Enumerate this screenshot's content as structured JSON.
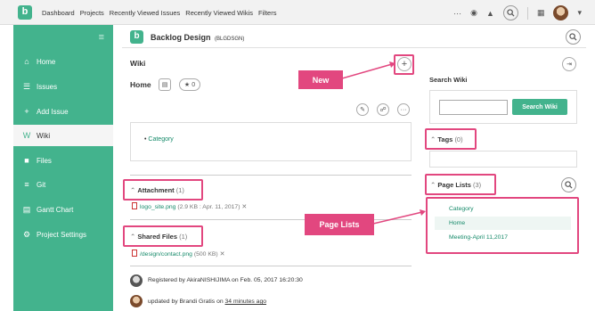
{
  "topnav": {
    "logo": "b",
    "items": [
      "Dashboard",
      "Projects",
      "Recently Viewed Issues",
      "Recently Viewed Wikis",
      "Filters"
    ],
    "more": "···"
  },
  "sidebar": {
    "toggle": "≡",
    "items": [
      {
        "label": "Home",
        "icon": "home-icon",
        "glyph": "⌂"
      },
      {
        "label": "Issues",
        "icon": "issues-icon",
        "glyph": "☰"
      },
      {
        "label": "Add Issue",
        "icon": "add-icon",
        "glyph": "+"
      },
      {
        "label": "Wiki",
        "icon": "wiki-icon",
        "glyph": "W"
      },
      {
        "label": "Files",
        "icon": "files-icon",
        "glyph": "■"
      },
      {
        "label": "Git",
        "icon": "git-icon",
        "glyph": "≡"
      },
      {
        "label": "Gantt Chart",
        "icon": "gantt-icon",
        "glyph": "▤"
      },
      {
        "label": "Project Settings",
        "icon": "gear-icon",
        "glyph": "⚙"
      }
    ]
  },
  "project": {
    "logo": "b",
    "title": "Backlog Design",
    "key": "(BLGDSGN)"
  },
  "wiki": {
    "section_title": "Wiki",
    "page_title": "Home",
    "star_count": "0",
    "content_items": [
      "Category"
    ],
    "attachment": {
      "label": "Attachment",
      "count": "(1)",
      "file": "logo_site.png",
      "meta": "(2.9 KB : Apr. 11, 2017)"
    },
    "shared_files": {
      "label": "Shared Files",
      "count": "(1)",
      "file": "/design/contact.png",
      "meta": "(500 KB)"
    },
    "history": [
      {
        "prefix": "Registered by AkiraNISHIJIMA on Feb. 05, 2017 16:20:30"
      },
      {
        "prefix": "updated by Brandi Gratis on ",
        "time": "34 minutes ago"
      }
    ]
  },
  "right": {
    "search_title": "Search Wiki",
    "search_placeholder": "",
    "search_button": "Search Wiki",
    "tags_label": "Tags",
    "tags_count": "(0)",
    "page_lists_label": "Page Lists",
    "page_lists_count": "(3)",
    "page_list": [
      "Category",
      "Home",
      "Meeting-April 11,2017"
    ]
  },
  "callouts": {
    "new": "New",
    "page_lists": "Page Lists"
  },
  "colors": {
    "accent": "#43b38d",
    "highlight": "#e2477f"
  }
}
